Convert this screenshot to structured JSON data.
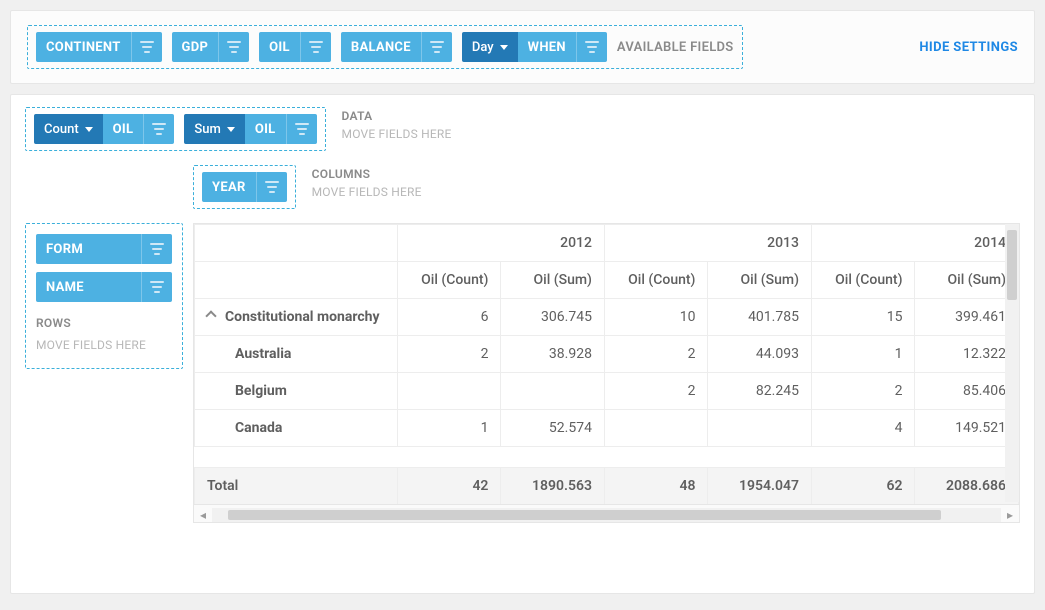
{
  "settings": {
    "available_fields_label": "AVAILABLE FIELDS",
    "hide_settings_label": "HIDE SETTINGS",
    "fields": [
      {
        "label": "CONTINENT"
      },
      {
        "label": "GDP"
      },
      {
        "label": "OIL"
      },
      {
        "label": "BALANCE"
      },
      {
        "label": "WHEN",
        "agg_label": "Day"
      }
    ]
  },
  "data_zone": {
    "title": "DATA",
    "hint": "MOVE FIELDS HERE",
    "fields": [
      {
        "agg_label": "Count",
        "label": "OIL"
      },
      {
        "agg_label": "Sum",
        "label": "OIL"
      }
    ]
  },
  "columns_zone": {
    "title": "COLUMNS",
    "hint": "MOVE FIELDS HERE",
    "fields": [
      {
        "label": "YEAR"
      }
    ]
  },
  "rows_zone": {
    "title": "ROWS",
    "hint": "MOVE FIELDS HERE",
    "fields": [
      {
        "label": "FORM"
      },
      {
        "label": "NAME"
      }
    ]
  },
  "pivot": {
    "years": [
      "2012",
      "2013",
      "2014"
    ],
    "measures": [
      "Oil (Count)",
      "Oil (Sum)"
    ],
    "rows": [
      {
        "label": "Constitutional monarchy",
        "level": 0,
        "expanded": true,
        "values": [
          "6",
          "306.745",
          "10",
          "401.785",
          "15",
          "399.461"
        ]
      },
      {
        "label": "Australia",
        "level": 1,
        "values": [
          "2",
          "38.928",
          "2",
          "44.093",
          "1",
          "12.322"
        ]
      },
      {
        "label": "Belgium",
        "level": 1,
        "values": [
          "",
          "",
          "2",
          "82.245",
          "2",
          "85.406"
        ]
      },
      {
        "label": "Canada",
        "level": 1,
        "values": [
          "1",
          "52.574",
          "",
          "",
          "4",
          "149.521"
        ]
      }
    ],
    "total_label": "Total",
    "total_values": [
      "42",
      "1890.563",
      "48",
      "1954.047",
      "62",
      "2088.686"
    ]
  }
}
